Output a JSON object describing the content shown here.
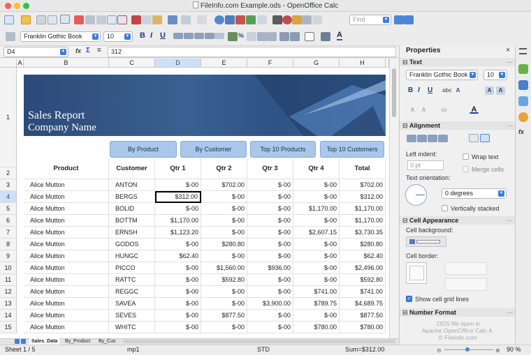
{
  "window": {
    "title": "FileInfo.com Example.ods - OpenOffice Calc"
  },
  "toolbar2": {
    "font": "Franklin Gothic Book",
    "size": "10"
  },
  "toolbar1": {
    "find_placeholder": "Find"
  },
  "formula": {
    "cell_ref": "D4",
    "value": "312",
    "fx": "fx",
    "sigma": "Σ",
    "equals": "="
  },
  "columns": [
    "A",
    "B",
    "C",
    "D",
    "E",
    "F",
    "G",
    "H"
  ],
  "banner": {
    "title": "Sales Report",
    "subtitle": "Company Name"
  },
  "buttons": [
    "By Product",
    "By Customer",
    "Top 10 Products",
    "Top 10 Customers"
  ],
  "headers": [
    "Product",
    "Customer",
    "Qtr 1",
    "Qtr 2",
    "Qtr 3",
    "Qtr 4",
    "Total"
  ],
  "rows": [
    {
      "n": "3",
      "cells": [
        "Alice Mutton",
        "ANTON",
        "$-00",
        "$702.00",
        "$-00",
        "$-00",
        "$702.00"
      ]
    },
    {
      "n": "4",
      "cells": [
        "Alice Mutton",
        "BERGS",
        "$312.00",
        "$-00",
        "$-00",
        "$-00",
        "$312.00"
      ]
    },
    {
      "n": "5",
      "cells": [
        "Alice Mutton",
        "BOLID",
        "$-00",
        "$-00",
        "$-00",
        "$1,170.00",
        "$1,170.00"
      ]
    },
    {
      "n": "6",
      "cells": [
        "Alice Mutton",
        "BOTTM",
        "$1,170.00",
        "$-00",
        "$-00",
        "$-00",
        "$1,170.00"
      ]
    },
    {
      "n": "7",
      "cells": [
        "Alice Mutton",
        "ERNSH",
        "$1,123.20",
        "$-00",
        "$-00",
        "$2,607.15",
        "$3,730.35"
      ]
    },
    {
      "n": "8",
      "cells": [
        "Alice Mutton",
        "GODOS",
        "$-00",
        "$280.80",
        "$-00",
        "$-00",
        "$280.80"
      ]
    },
    {
      "n": "9",
      "cells": [
        "Alice Mutton",
        "HUNGC",
        "$62.40",
        "$-00",
        "$-00",
        "$-00",
        "$62.40"
      ]
    },
    {
      "n": "10",
      "cells": [
        "Alice Mutton",
        "PICCO",
        "$-00",
        "$1,560.00",
        "$936.00",
        "$-00",
        "$2,496.00"
      ]
    },
    {
      "n": "11",
      "cells": [
        "Alice Mutton",
        "RATTC",
        "$-00",
        "$592.80",
        "$-00",
        "$-00",
        "$592.80"
      ]
    },
    {
      "n": "12",
      "cells": [
        "Alice Mutton",
        "REGGC",
        "$-00",
        "$-00",
        "$-00",
        "$741.00",
        "$741.00"
      ]
    },
    {
      "n": "13",
      "cells": [
        "Alice Mutton",
        "SAVEA",
        "$-00",
        "$-00",
        "$3,900.00",
        "$789.75",
        "$4,689.75"
      ]
    },
    {
      "n": "14",
      "cells": [
        "Alice Mutton",
        "SEVES",
        "$-00",
        "$877.50",
        "$-00",
        "$-00",
        "$877.50"
      ]
    },
    {
      "n": "15",
      "cells": [
        "Alice Mutton",
        "WHITC",
        "$-00",
        "$-00",
        "$-00",
        "$780.00",
        "$780.00"
      ]
    }
  ],
  "sheet_tabs": [
    "Sales_Data",
    "By_Product",
    "By_Cus"
  ],
  "status": {
    "sheet": "Sheet 1 / 5",
    "style": "mp1",
    "mode": "STD",
    "sum": "Sum=$312.00",
    "zoom": "90 %"
  },
  "sidebar": {
    "title": "Properties",
    "close": "×",
    "text_section": "Text",
    "font": "Franklin Gothic Book",
    "size": "10",
    "alignment_section": "Alignment",
    "left_indent_label": "Left indent:",
    "left_indent_value": "0 pt",
    "wrap_text": "Wrap text",
    "merge_cells": "Merge cells",
    "orientation_label": "Text orientation:",
    "orientation_value": "0 degrees",
    "vertically_stacked": "Vertically stacked",
    "cell_appearance_section": "Cell Appearance",
    "cell_background_label": "Cell background:",
    "cell_border_label": "Cell border:",
    "show_grid_lines": "Show cell grid lines",
    "number_format_section": "Number Format"
  },
  "watermark": [
    ".ODS file open in",
    "Apache OpenOffice Calc 4.",
    "© FileInfo.com"
  ],
  "colors": {
    "banner": "#2c4a78",
    "button": "#a9c8ea",
    "accent": "#3b7de0"
  }
}
